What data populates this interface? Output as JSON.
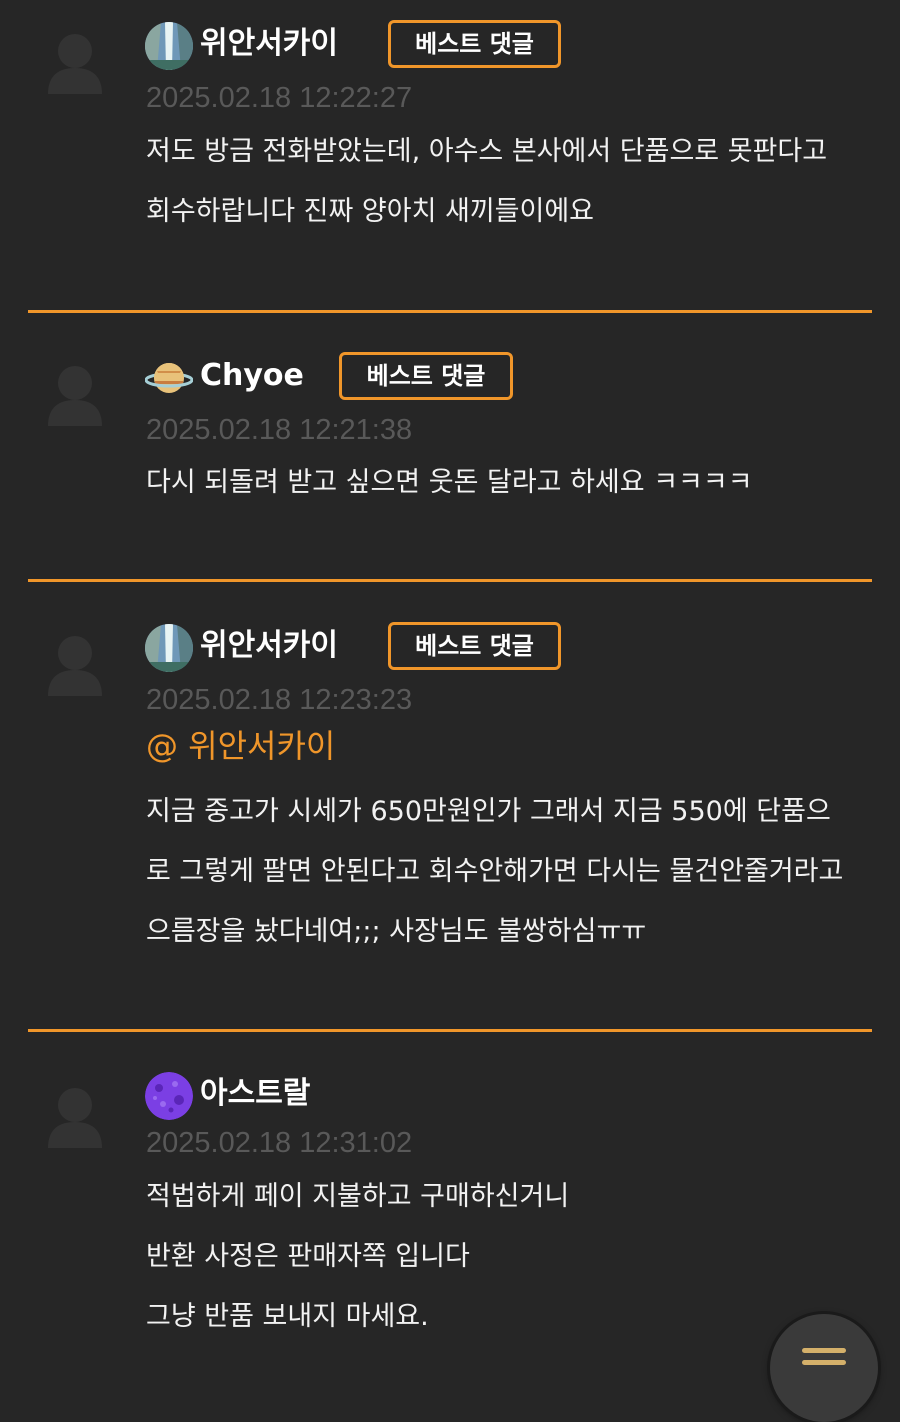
{
  "colors": {
    "background": "#262626",
    "accent": "#f0962a",
    "timestamp": "#595959",
    "text": "#f2f2f2"
  },
  "comments": [
    {
      "avatar_icon": "user-placeholder-icon",
      "badge_icon": "waterfall-badge-icon",
      "nickname": "위안서카이",
      "best_label": "베스트 댓글",
      "timestamp": "2025.02.18 12:22:27",
      "lines": [
        "저도 방금 전화받았는데, 아수스 본사에서 단품으로 못판다고",
        "회수하랍니다 진짜 양아치 새끼들이에요"
      ]
    },
    {
      "avatar_icon": "user-placeholder-icon",
      "badge_icon": "saturn-badge-icon",
      "nickname": "Chyoe",
      "best_label": "베스트 댓글",
      "timestamp": "2025.02.18 12:21:38",
      "lines": [
        "다시 되돌려 받고 싶으면 웃돈 달라고 하세요 ㅋㅋㅋㅋ"
      ]
    },
    {
      "avatar_icon": "user-placeholder-icon",
      "badge_icon": "waterfall-badge-icon",
      "nickname": "위안서카이",
      "best_label": "베스트 댓글",
      "timestamp": "2025.02.18 12:23:23",
      "mention": "@ 위안서카이",
      "lines": [
        "지금 중고가 시세가 650만원인가 그래서 지금 550에 단품으",
        "로 그렇게 팔면 안된다고 회수안해가면 다시는 물건안줄거라고",
        "으름장을 놨다네여;;; 사장님도 불쌍하심ㅠㅠ"
      ]
    },
    {
      "avatar_icon": "user-placeholder-icon",
      "badge_icon": "purple-planet-badge-icon",
      "nickname": "아스트랄",
      "timestamp": "2025.02.18 12:31:02",
      "lines": [
        "적법하게 페이 지불하고 구매하신거니",
        "반환 사정은 판매자쪽 입니다",
        "그냥 반품 보내지 마세요."
      ]
    }
  ],
  "fab": {
    "icon": "menu-icon"
  }
}
